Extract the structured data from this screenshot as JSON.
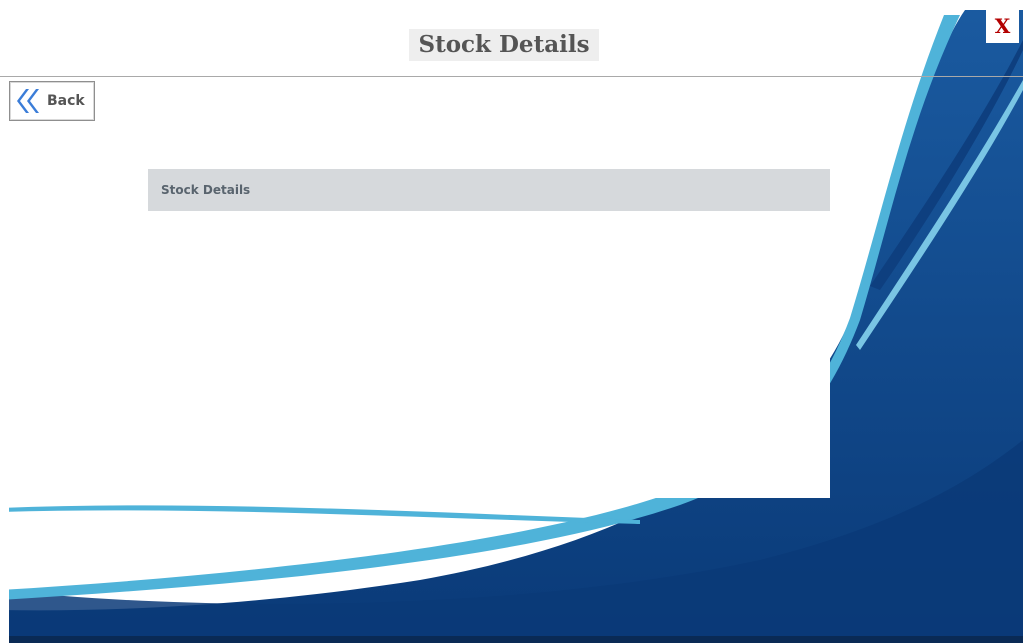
{
  "header": {
    "title": "Stock Details"
  },
  "toolbar": {
    "back_label": "Back",
    "back_icon": "double-chevron-left-icon",
    "close_label": "X"
  },
  "panel": {
    "title": "Stock Details",
    "items": []
  },
  "colors": {
    "navy": "#0a3a78",
    "navy_light": "#1a5aa0",
    "sky": "#4fb3d9",
    "back_icon": "#3b7dd8",
    "close": "#b30000",
    "panel_header_bg": "#d6d9dc"
  }
}
